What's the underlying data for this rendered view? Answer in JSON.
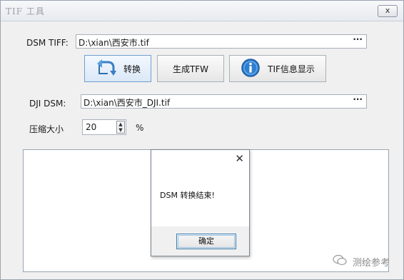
{
  "window": {
    "title": "TIF 工具",
    "close_label": "x"
  },
  "dsm_tiff": {
    "label": "DSM TIFF:",
    "value": "D:\\xian\\西安市.tif",
    "browse": "···"
  },
  "buttons": {
    "convert": "转换",
    "generate_tfw": "生成TFW",
    "tif_info": "TIF信息显示"
  },
  "dji_dsm": {
    "label": "DJI DSM:",
    "value": "D:\\xian\\西安市_DJI.tif",
    "browse": "···"
  },
  "compress": {
    "label": "压缩大小",
    "value": "20",
    "unit": "%"
  },
  "dialog": {
    "close": "✕",
    "message": "DSM 转换结束!",
    "ok_label": "确定"
  },
  "watermark": {
    "text": "测绘参考"
  }
}
